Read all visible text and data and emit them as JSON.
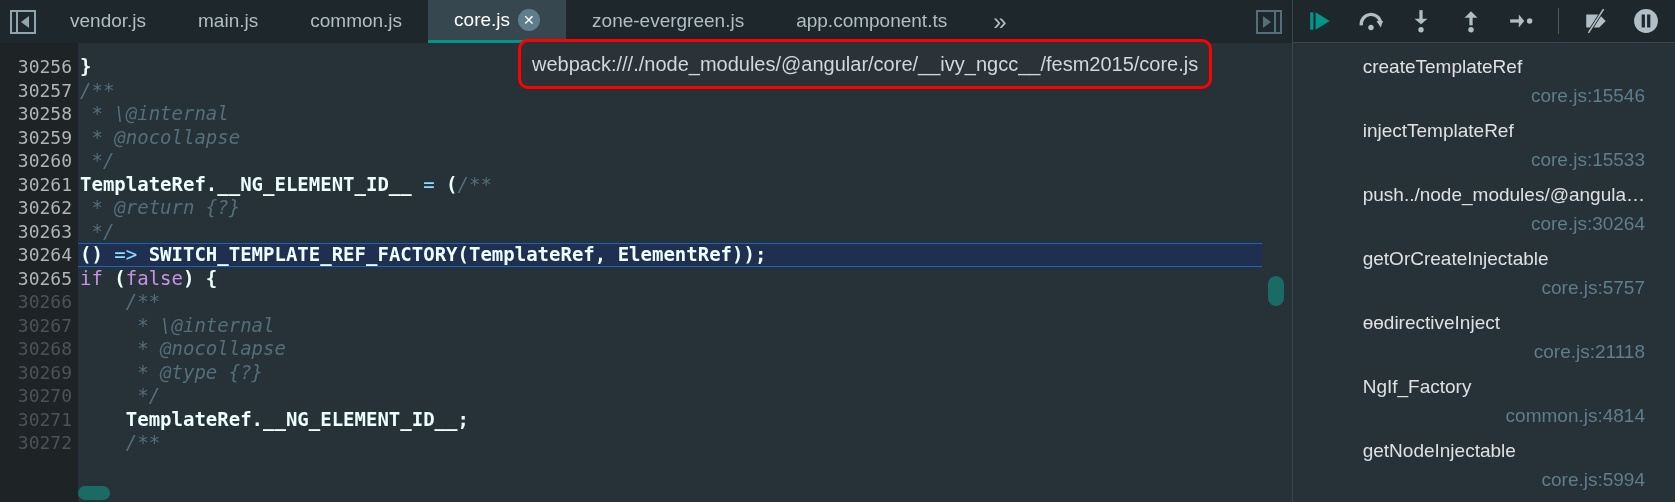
{
  "tabs": [
    {
      "label": "vendor.js",
      "selected": false
    },
    {
      "label": "main.js",
      "selected": false
    },
    {
      "label": "common.js",
      "selected": false
    },
    {
      "label": "core.js",
      "selected": true,
      "close": "✕"
    },
    {
      "label": "zone-evergreen.js",
      "selected": false
    },
    {
      "label": "app.component.ts",
      "selected": false
    }
  ],
  "more_tabs": "»",
  "tooltip": "webpack:///./node_modules/@angular/core/__ivy_ngcc__/fesm2015/core.js",
  "code_lines": [
    {
      "number": "30256",
      "selected": false,
      "faded": false,
      "tokens": [
        {
          "kind": "plain",
          "text": "}"
        }
      ]
    },
    {
      "number": "30257",
      "selected": false,
      "faded": false,
      "tokens": [
        {
          "kind": "comment",
          "text": "/**"
        }
      ]
    },
    {
      "number": "30258",
      "selected": false,
      "faded": false,
      "tokens": [
        {
          "kind": "comment",
          "text": " * \\@internal"
        }
      ]
    },
    {
      "number": "30259",
      "selected": false,
      "faded": false,
      "tokens": [
        {
          "kind": "comment",
          "text": " * @nocollapse"
        }
      ]
    },
    {
      "number": "30260",
      "selected": false,
      "faded": false,
      "tokens": [
        {
          "kind": "comment",
          "text": " */"
        }
      ]
    },
    {
      "number": "30261",
      "selected": false,
      "faded": false,
      "tokens": [
        {
          "kind": "plain",
          "text": "TemplateRef.__NG_ELEMENT_ID__ "
        },
        {
          "kind": "operator",
          "text": "="
        },
        {
          "kind": "plain",
          "text": " ("
        },
        {
          "kind": "comment",
          "text": "/**"
        }
      ]
    },
    {
      "number": "30262",
      "selected": false,
      "faded": false,
      "tokens": [
        {
          "kind": "comment",
          "text": " * @return {?}"
        }
      ]
    },
    {
      "number": "30263",
      "selected": false,
      "faded": false,
      "tokens": [
        {
          "kind": "comment",
          "text": " */"
        }
      ]
    },
    {
      "number": "30264",
      "selected": true,
      "faded": false,
      "tokens": [
        {
          "kind": "plain",
          "text": "() "
        },
        {
          "kind": "operator",
          "text": "=>"
        },
        {
          "kind": "plain",
          "text": " SWITCH_TEMPLATE_REF_FACTORY(TemplateRef, ElementRef));"
        }
      ]
    },
    {
      "number": "30265",
      "selected": false,
      "faded": false,
      "tokens": [
        {
          "kind": "keyword",
          "text": "if"
        },
        {
          "kind": "plain",
          "text": " ("
        },
        {
          "kind": "keyword",
          "text": "false"
        },
        {
          "kind": "plain",
          "text": ") {"
        }
      ]
    },
    {
      "number": "30266",
      "selected": false,
      "faded": true,
      "tokens": [
        {
          "kind": "comment",
          "text": "    /**"
        }
      ]
    },
    {
      "number": "30267",
      "selected": false,
      "faded": true,
      "tokens": [
        {
          "kind": "comment",
          "text": "     * \\@internal"
        }
      ]
    },
    {
      "number": "30268",
      "selected": false,
      "faded": true,
      "tokens": [
        {
          "kind": "comment",
          "text": "     * @nocollapse"
        }
      ]
    },
    {
      "number": "30269",
      "selected": false,
      "faded": true,
      "tokens": [
        {
          "kind": "comment",
          "text": "     * @type {?}"
        }
      ]
    },
    {
      "number": "30270",
      "selected": false,
      "faded": true,
      "tokens": [
        {
          "kind": "comment",
          "text": "     */"
        }
      ]
    },
    {
      "number": "30271",
      "selected": false,
      "faded": true,
      "tokens": [
        {
          "kind": "plain",
          "text": "    TemplateRef.__NG_ELEMENT_ID__;"
        }
      ]
    },
    {
      "number": "30272",
      "selected": false,
      "faded": true,
      "tokens": [
        {
          "kind": "comment",
          "text": "    /**"
        }
      ]
    }
  ],
  "call_stack": [
    {
      "function": "createTemplateRef",
      "location": "core.js:15546"
    },
    {
      "function": "injectTemplateRef",
      "location": "core.js:15533"
    },
    {
      "function": "push../node_modules/@angula…",
      "location": "core.js:30264"
    },
    {
      "function": "getOrCreateInjectable",
      "location": "core.js:5757"
    },
    {
      "function": "ɵɵdirectiveInject",
      "location": "core.js:21118"
    },
    {
      "function": "NgIf_Factory",
      "location": "common.js:4814"
    },
    {
      "function": "getNodeInjectable",
      "location": "core.js:5994"
    }
  ]
}
